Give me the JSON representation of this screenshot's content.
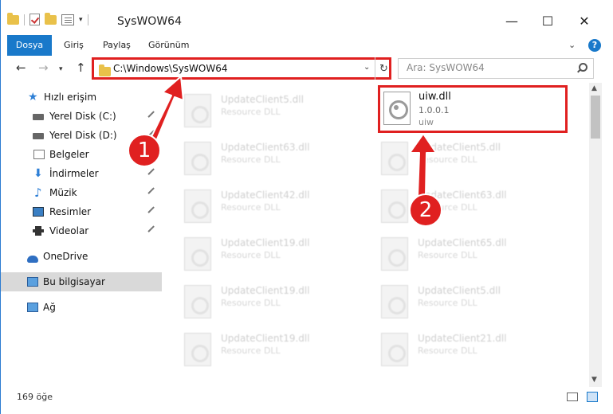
{
  "window": {
    "title": "SysWOW64",
    "min_glyph": "—",
    "max_glyph": "☐",
    "close_glyph": "✕"
  },
  "ribbon": {
    "tabs": [
      {
        "label": "Dosya",
        "active": true
      },
      {
        "label": "Giriş"
      },
      {
        "label": "Paylaş"
      },
      {
        "label": "Görünüm"
      }
    ],
    "help": "?"
  },
  "nav": {
    "address": "C:\\Windows\\SysWOW64",
    "search_placeholder": "Ara: SysWOW64"
  },
  "sidebar": {
    "items": [
      {
        "label": "Hızlı erişim",
        "icon": "star-icon"
      },
      {
        "label": "Yerel Disk (C:)",
        "icon": "drive-icon"
      },
      {
        "label": "Yerel Disk (D:)",
        "icon": "drive-icon"
      },
      {
        "label": "Belgeler",
        "icon": "documents-icon"
      },
      {
        "label": "İndirmeler",
        "icon": "downloads-icon"
      },
      {
        "label": "Müzik",
        "icon": "music-icon"
      },
      {
        "label": "Resimler",
        "icon": "pictures-icon"
      },
      {
        "label": "Videolar",
        "icon": "videos-icon"
      },
      {
        "label": "OneDrive",
        "icon": "onedrive-icon"
      },
      {
        "label": "Bu bilgisayar",
        "icon": "this-pc-icon"
      },
      {
        "label": "Ağ",
        "icon": "network-icon"
      }
    ]
  },
  "files": {
    "left": [
      {
        "name": "UpdateClient5.dll",
        "desc": "Resource DLL"
      },
      {
        "name": "UpdateClient63.dll",
        "desc": "Resource DLL"
      },
      {
        "name": "UpdateClient42.dll",
        "desc": "Resource DLL"
      },
      {
        "name": "UpdateClient19.dll",
        "desc": "Resource DLL"
      },
      {
        "name": "UpdateClient19.dll",
        "desc": "Resource DLL"
      },
      {
        "name": "UpdateClient19.dll",
        "desc": "Resource DLL"
      }
    ],
    "right": [
      {
        "name": "UpdateClient5.dll",
        "desc": "Resource DLL"
      },
      {
        "name": "UpdateClient63.dll",
        "desc": "Resource DLL"
      },
      {
        "name": "UpdateClient65.dll",
        "desc": "Resource DLL"
      },
      {
        "name": "UpdateClient5.dll",
        "desc": "Resource DLL"
      },
      {
        "name": "UpdateClient21.dll",
        "desc": "Resource DLL"
      }
    ],
    "highlighted": {
      "name": "uiw.dll",
      "version": "1.0.0.1",
      "company": "uiw"
    }
  },
  "status": {
    "count": "169 öğe"
  },
  "annotations": {
    "step1": "1",
    "step2": "2",
    "color": "#e02020"
  }
}
